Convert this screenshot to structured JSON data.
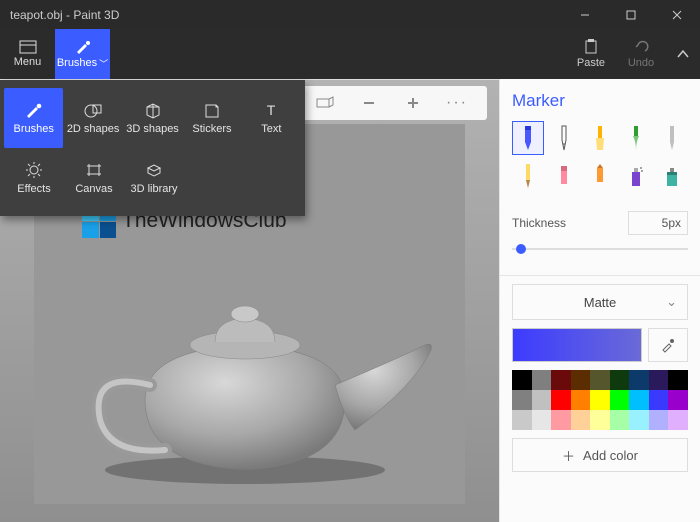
{
  "window": {
    "title": "teapot.obj - Paint 3D"
  },
  "menubar": {
    "menu": "Menu",
    "brushes": "Brushes",
    "paste": "Paste",
    "undo": "Undo"
  },
  "dropdown": {
    "brushes": "Brushes",
    "shapes2d": "2D shapes",
    "shapes3d": "3D shapes",
    "stickers": "Stickers",
    "text": "Text",
    "effects": "Effects",
    "canvas": "Canvas",
    "library3d": "3D library"
  },
  "watermark": {
    "text": "TheWindowsClub"
  },
  "side": {
    "heading": "Marker",
    "thickness_label": "Thickness",
    "thickness_value": "5px",
    "material": "Matte",
    "add_color": "Add color"
  },
  "palette": {
    "row1": [
      "#000000",
      "#7f7f7f",
      "#6b0a0a",
      "#5b2d00",
      "#56562d",
      "#0e3a0e",
      "#0b3a6b",
      "#2b1a5b",
      "#000000"
    ],
    "row2": [
      "#808080",
      "#c0c0c0",
      "#ff0000",
      "#ff8000",
      "#ffff00",
      "#00ff00",
      "#00bfff",
      "#3a3aff",
      "#9900cc"
    ],
    "row3": [
      "#c9c9c9",
      "#e6e6e6",
      "#ff9aa2",
      "#ffd199",
      "#ffff99",
      "#a6ffa6",
      "#99f0ff",
      "#b0b0ff",
      "#e0b0ff"
    ]
  }
}
